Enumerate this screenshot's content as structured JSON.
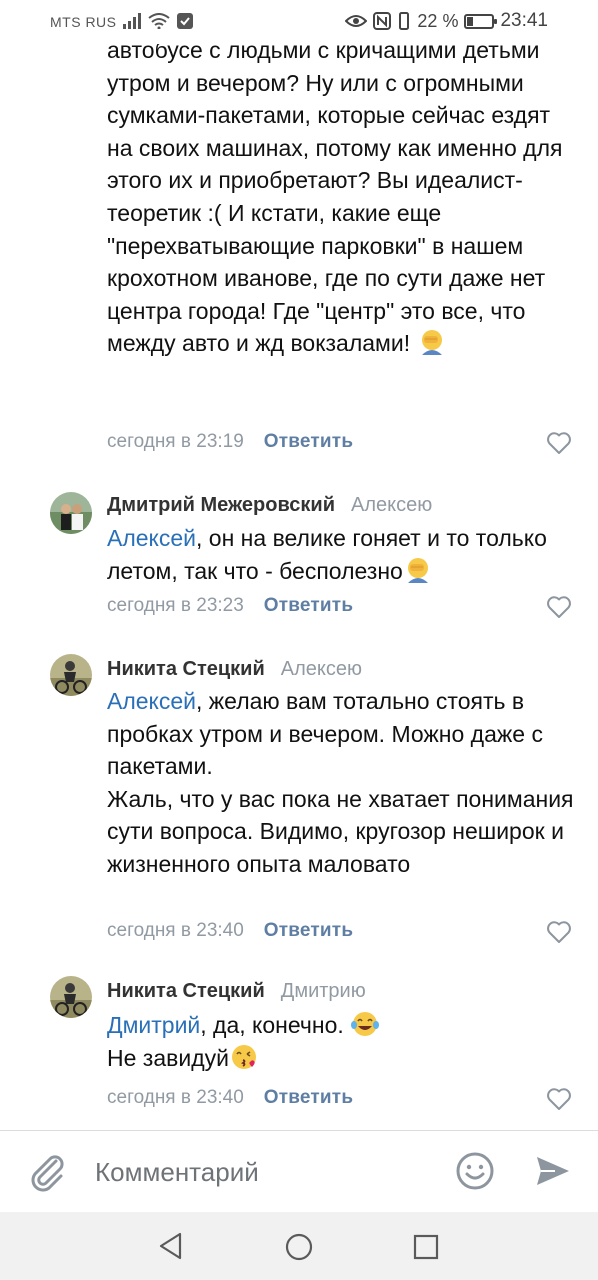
{
  "status_bar": {
    "carrier": "MTS RUS",
    "battery": "22 %",
    "battery_level": 0.22,
    "time": "23:41"
  },
  "comments": [
    {
      "text": "автобусе с людьми с кричащими детьми утром и вечером? Ну или с огромными сумками-пакетами, которые сейчас ездят на своих машинах, потому как именно для этого их и приобретают? Вы идеалист-теоретик :( И кстати, какие еще \"перехватывающие парковки\" в нашем крохотном иванове, где по сути даже нет центра города! Где \"центр\" это все, что между авто и жд вокзалами!",
      "time": "сегодня в 23:19",
      "reply": "Ответить"
    },
    {
      "author": "Дмитрий Межеровский",
      "recipient": "Алексею",
      "mention": "Алексей",
      "text": ", он на велике гоняет и то только летом, так что - бесполезно",
      "time": "сегодня в 23:23",
      "reply": "Ответить"
    },
    {
      "author": "Никита Стецкий",
      "recipient": "Алексею",
      "mention": "Алексей",
      "text": ", желаю вам тотально стоять в пробках утром и вечером. Можно даже с пакетами.\nЖаль, что у вас пока не хватает понимания сути вопроса. Видимо, кругозор неширок и жизненного опыта маловато",
      "time": "сегодня в 23:40",
      "reply": "Ответить"
    },
    {
      "author": "Никита Стецкий",
      "recipient": "Дмитрию",
      "mention": "Дмитрий",
      "text": ", да, конечно.",
      "text2": "Не завидуй",
      "time": "сегодня в 23:40",
      "reply": "Ответить"
    }
  ],
  "composer": {
    "placeholder": "Комментарий"
  },
  "icons": {
    "attach": "paperclip-icon",
    "emoji": "smiley-icon",
    "send": "send-icon",
    "like": "heart-icon"
  },
  "colors": {
    "link": "#2a70b8",
    "meta": "#919aa3",
    "reply": "#5f7ea3"
  }
}
